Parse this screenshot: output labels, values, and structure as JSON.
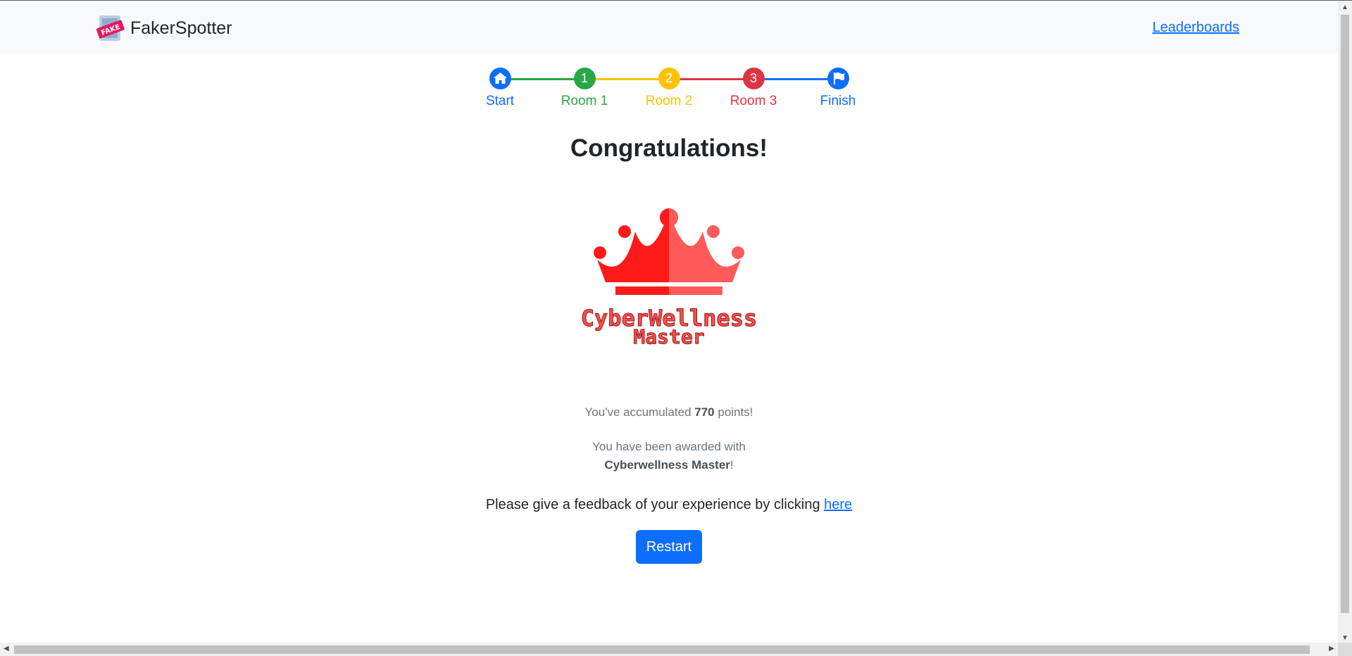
{
  "navbar": {
    "brand_name": "FakerSpotter",
    "logo_text": "FAKE",
    "leaderboards_label": "Leaderboards"
  },
  "steps": [
    {
      "label": "Start",
      "icon": "home-icon",
      "color": "#0d6efd"
    },
    {
      "label": "Room 1",
      "number": "1",
      "color": "#28a745"
    },
    {
      "label": "Room 2",
      "number": "2",
      "color": "#ffc107"
    },
    {
      "label": "Room 3",
      "number": "3",
      "color": "#dc3545"
    },
    {
      "label": "Finish",
      "icon": "flag-icon",
      "color": "#0d6efd"
    }
  ],
  "main": {
    "title": "Congratulations!",
    "badge": {
      "line1": "CyberWellness",
      "line2": "Master",
      "color": "#ff2a2a"
    },
    "points_prefix": "You've accumulated ",
    "points_value": "770",
    "points_suffix": " points!",
    "award_prefix": "You have been awarded with",
    "award_name": "Cyberwellness Master",
    "award_suffix": "!",
    "feedback_text": "Please give a feedback of your experience by clicking ",
    "feedback_link": "here",
    "restart_label": "Restart"
  }
}
